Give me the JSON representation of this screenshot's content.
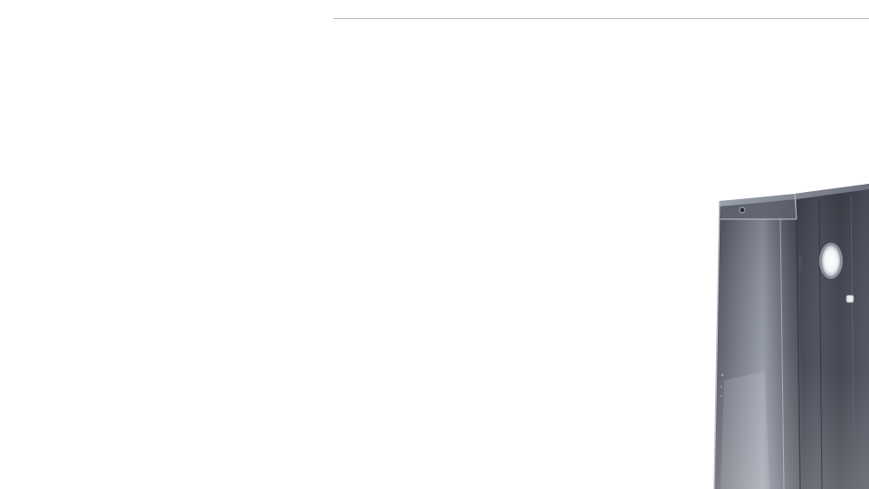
{
  "scene": {
    "background_color": "#ffffff",
    "rule_color": "#b9b9bd",
    "object": "steel-electrical-enclosure",
    "object_colors": {
      "dark": "#3a3d46",
      "mid": "#5c6170",
      "light": "#9aa0ac",
      "highlight": "#e6e8ec"
    }
  }
}
